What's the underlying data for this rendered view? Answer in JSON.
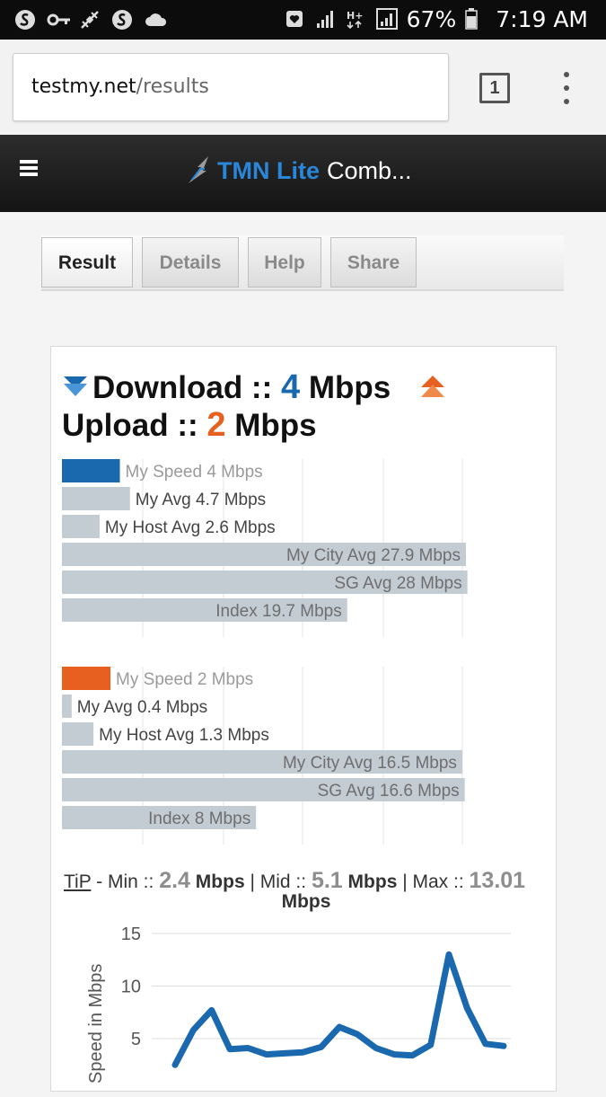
{
  "status_bar": {
    "battery_percent": "67%",
    "time": "7:19 AM",
    "icons": [
      "swiftkey-icon",
      "key-icon",
      "satellite-icon",
      "swiftkey-icon",
      "cloud-icon",
      "heart-box-icon",
      "signal-icon",
      "hplus-icon",
      "signal-box-icon",
      "battery-icon"
    ]
  },
  "browser": {
    "url_host": "testmy.net",
    "url_path": "/results",
    "tab_count": "1"
  },
  "site_header": {
    "brand_name": "TMN Lite",
    "brand_rest": "Comb..."
  },
  "tabs": [
    {
      "label": "Result",
      "active": true
    },
    {
      "label": "Details",
      "active": false
    },
    {
      "label": "Help",
      "active": false
    },
    {
      "label": "Share",
      "active": false
    }
  ],
  "result": {
    "download_label": "Download ::",
    "download_value": "4",
    "download_unit": "Mbps",
    "upload_label": "Upload ::",
    "upload_value": "2",
    "upload_unit": "Mbps"
  },
  "colors": {
    "download": "#1a68ae",
    "upload": "#e8601f",
    "bar_grey": "#c3cbd3",
    "line": "#1a68ae"
  },
  "chart_data": [
    {
      "type": "bar",
      "categories": [
        "My Speed 4 Mbps",
        "My Avg 4.7 Mbps",
        "My Host Avg 2.6 Mbps",
        "My City Avg 27.9 Mbps",
        "SG Avg 28 Mbps",
        "Index 19.7 Mbps"
      ],
      "values": [
        4,
        4.7,
        2.6,
        27.9,
        28,
        19.7
      ],
      "xlim": [
        0,
        31
      ]
    },
    {
      "type": "bar",
      "categories": [
        "My Speed 2 Mbps",
        "My Avg 0.4 Mbps",
        "My Host Avg 1.3 Mbps",
        "My City Avg 16.5 Mbps",
        "SG Avg 16.6 Mbps",
        "Index 8 Mbps"
      ],
      "values": [
        2,
        0.4,
        1.3,
        16.5,
        16.6,
        8
      ],
      "xlim": [
        0,
        18.5
      ]
    },
    {
      "type": "line",
      "ylabel": "Speed in Mbps",
      "yticks": [
        5,
        10,
        15
      ],
      "ylim": [
        0,
        15
      ],
      "values": [
        2.5,
        5.8,
        7.7,
        4.0,
        4.1,
        3.5,
        3.6,
        3.7,
        4.2,
        6.1,
        5.4,
        4.1,
        3.5,
        3.4,
        4.4,
        13.0,
        7.9,
        4.5,
        4.3
      ]
    }
  ],
  "tip": {
    "link": "TiP",
    "min_label": " - Min :: ",
    "min_value": "2.4",
    "mid_label": " | Mid :: ",
    "mid_value": "5.1",
    "max_label": " | Max :: ",
    "max_value": "13.01",
    "unit": "Mbps"
  }
}
